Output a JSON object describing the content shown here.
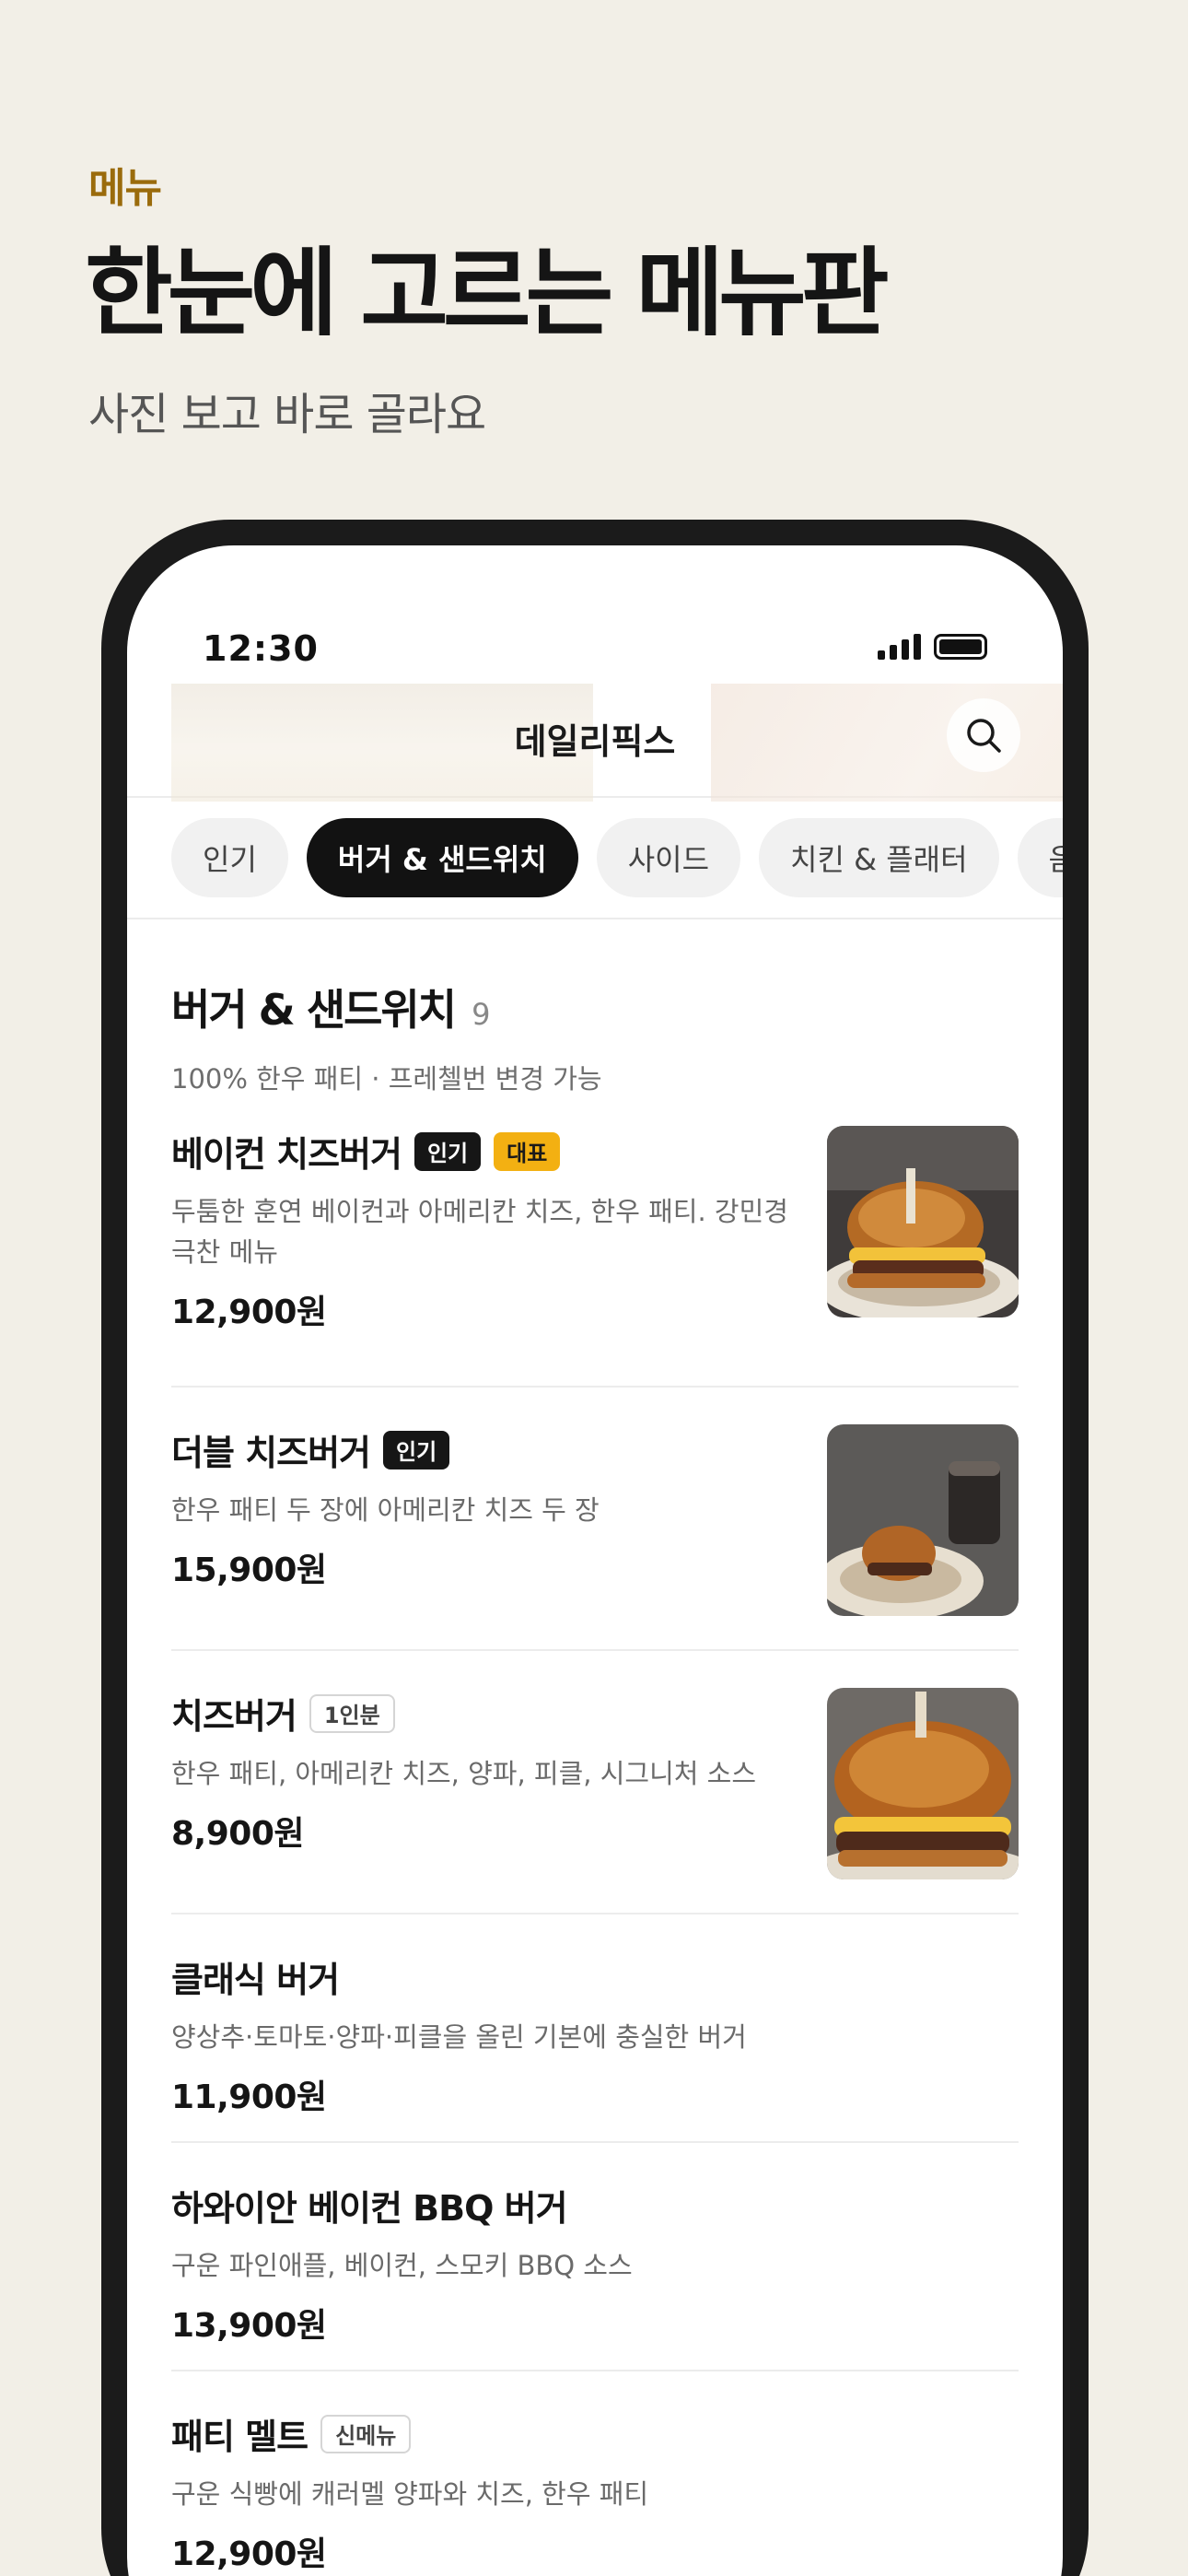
{
  "promo": {
    "eyebrow": "메뉴",
    "headline": "한눈에 고르는 메뉴판",
    "subhead": "사진 보고 바로 골라요"
  },
  "status_bar": {
    "time": "12:30"
  },
  "topbar": {
    "title": "데일리픽스",
    "search_icon": "search-icon"
  },
  "categories": [
    {
      "label": "인기",
      "active": false
    },
    {
      "label": "버거 & 샌드위치",
      "active": true
    },
    {
      "label": "사이드",
      "active": false
    },
    {
      "label": "치킨 & 플래터",
      "active": false
    },
    {
      "label": "음료",
      "active": false
    }
  ],
  "section": {
    "title": "버거 & 샌드위치",
    "count": "9",
    "description": "100% 한우 패티 · 프레첼번 변경 가능"
  },
  "menu_items": [
    {
      "name": "베이컨 치즈버거",
      "badges": [
        {
          "label": "인기",
          "style": "dark"
        },
        {
          "label": "대표",
          "style": "yellow"
        }
      ],
      "description": "두툼한 훈연 베이컨과 아메리칸 치즈, 한우 패티. 강민경 극찬 메뉴",
      "price": "12,900원",
      "image": "bacon-cheeseburger-photo"
    },
    {
      "name": "더블 치즈버거",
      "badges": [
        {
          "label": "인기",
          "style": "dark"
        }
      ],
      "description": "한우 패티 두 장에 아메리칸 치즈 두 장",
      "price": "15,900원",
      "image": "double-cheeseburger-photo"
    },
    {
      "name": "치즈버거",
      "badges": [
        {
          "label": "1인분",
          "style": "outline"
        }
      ],
      "description": "한우 패티, 아메리칸 치즈, 양파, 피클, 시그니처 소스",
      "price": "8,900원",
      "image": "cheeseburger-photo"
    },
    {
      "name": "클래식 버거",
      "badges": [],
      "description": "양상추·토마토·양파·피클을 올린 기본에 충실한 버거",
      "price": "11,900원"
    },
    {
      "name": "하와이안 베이컨 BBQ 버거",
      "badges": [],
      "description": "구운 파인애플, 베이컨, 스모키 BBQ 소스",
      "price": "13,900원"
    },
    {
      "name": "패티 멜트",
      "badges": [
        {
          "label": "신메뉴",
          "style": "outline"
        }
      ],
      "description": "구운 식빵에 캐러멜 양파와 치즈, 한우 패티",
      "price": "12,900원"
    }
  ],
  "colors": {
    "background": "#f2efe7",
    "eyebrow": "#9a6b0c",
    "accent_badge": "#f3b012",
    "active_chip": "#121212"
  }
}
